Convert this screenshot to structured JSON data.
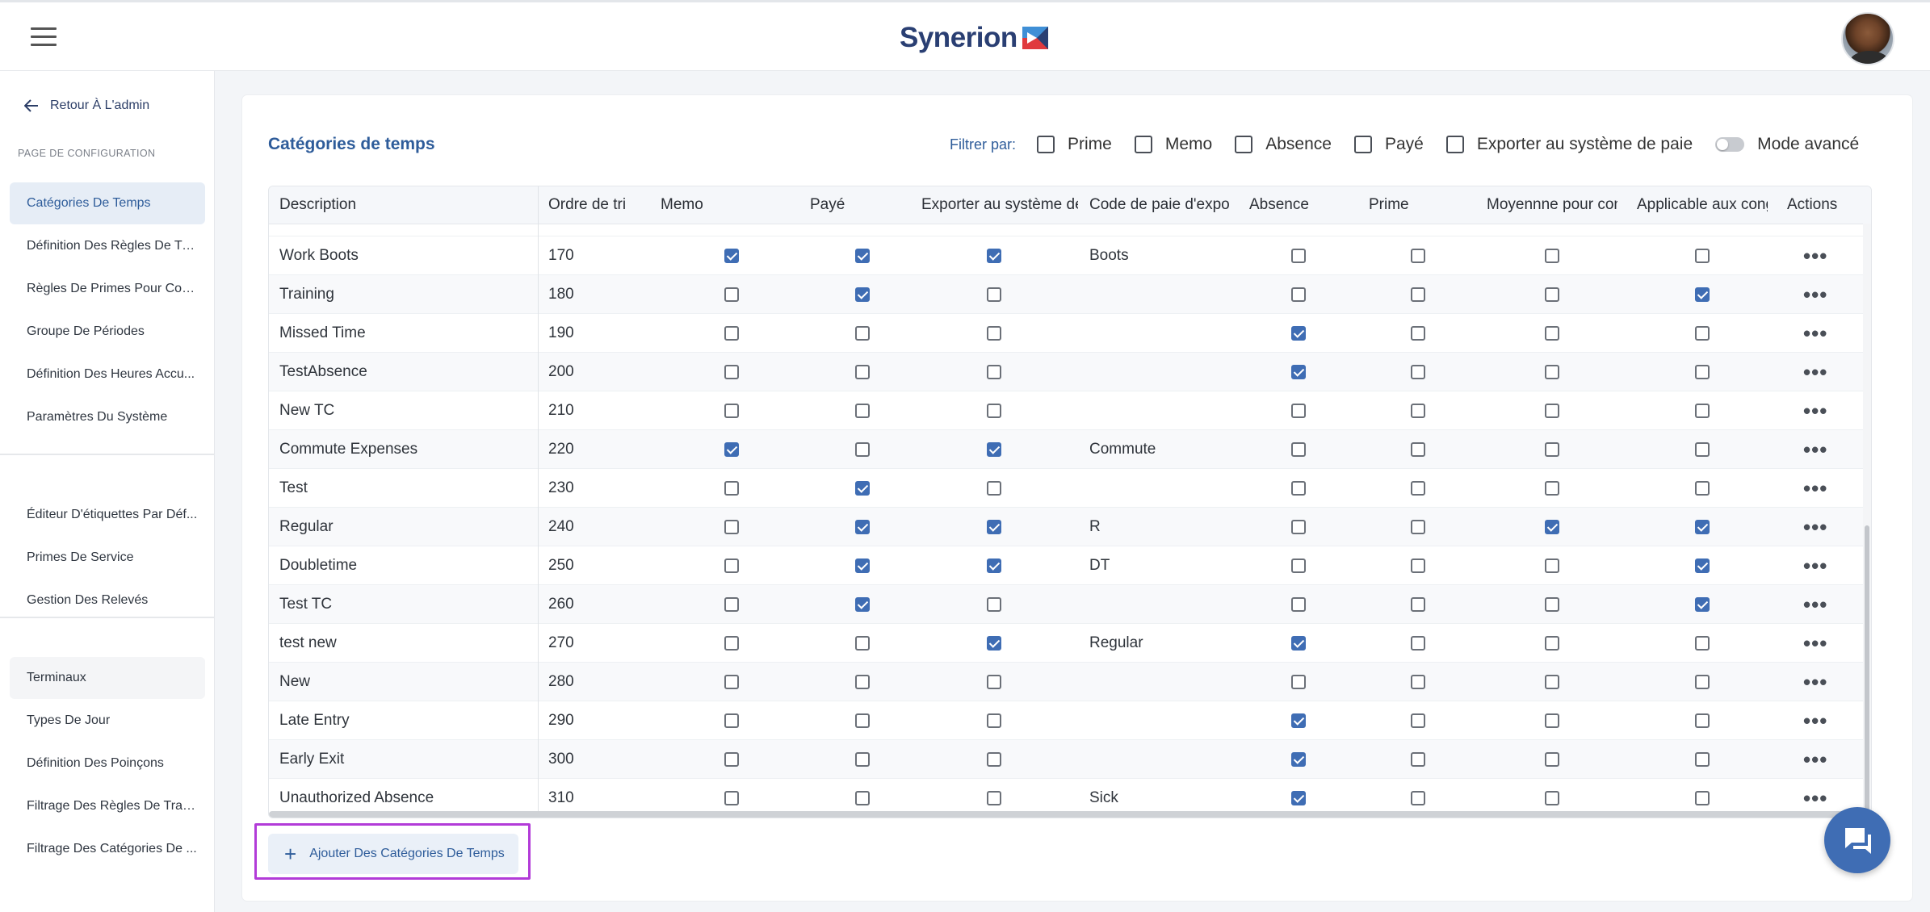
{
  "header": {
    "logo_text": "Synerion"
  },
  "sidebar": {
    "back_label": "Retour À L'admin",
    "section_title": "PAGE DE CONFIGURATION",
    "group1": [
      "Catégories De Temps",
      "Définition Des Règles De Travail",
      "Règles De Primes Pour Con...",
      "Groupe De Périodes",
      "Définition Des Heures Accu...",
      "Paramètres Du Système"
    ],
    "group2": [
      "Éditeur D'étiquettes Par Déf...",
      "Primes De Service",
      "Gestion Des Relevés"
    ],
    "group3": [
      "Terminaux",
      "Types De Jour",
      "Définition Des Poinçons",
      "Filtrage Des Règles De Trav...",
      "Filtrage Des Catégories De ..."
    ]
  },
  "page": {
    "title": "Catégories de temps"
  },
  "filters": {
    "label": "Filtrer par:",
    "items": [
      "Prime",
      "Memo",
      "Absence",
      "Payé",
      "Exporter au système de paie"
    ],
    "advanced_label": "Mode avancé"
  },
  "table": {
    "headers": [
      "Description",
      "Ordre de tri",
      "Memo",
      "Payé",
      "Exporter au système de paie",
      "Code de paie d'exportation",
      "Absence",
      "Prime",
      "Moyennne pour congé",
      "Applicable aux congés",
      "Actions"
    ],
    "rows": [
      {
        "desc": "Work Boots",
        "order": "170",
        "memo": true,
        "paye": true,
        "export": true,
        "code": "Boots",
        "absence": false,
        "prime": false,
        "moy": false,
        "app": false
      },
      {
        "desc": "Training",
        "order": "180",
        "memo": false,
        "paye": true,
        "export": false,
        "code": "",
        "absence": false,
        "prime": false,
        "moy": false,
        "app": true
      },
      {
        "desc": "Missed Time",
        "order": "190",
        "memo": false,
        "paye": false,
        "export": false,
        "code": "",
        "absence": true,
        "prime": false,
        "moy": false,
        "app": false
      },
      {
        "desc": "TestAbsence",
        "order": "200",
        "memo": false,
        "paye": false,
        "export": false,
        "code": "",
        "absence": true,
        "prime": false,
        "moy": false,
        "app": false
      },
      {
        "desc": "New TC",
        "order": "210",
        "memo": false,
        "paye": false,
        "export": false,
        "code": "",
        "absence": false,
        "prime": false,
        "moy": false,
        "app": false
      },
      {
        "desc": "Commute Expenses",
        "order": "220",
        "memo": true,
        "paye": false,
        "export": true,
        "code": "Commute",
        "absence": false,
        "prime": false,
        "moy": false,
        "app": false
      },
      {
        "desc": "Test",
        "order": "230",
        "memo": false,
        "paye": true,
        "export": false,
        "code": "",
        "absence": false,
        "prime": false,
        "moy": false,
        "app": false
      },
      {
        "desc": "Regular",
        "order": "240",
        "memo": false,
        "paye": true,
        "export": true,
        "code": "R",
        "absence": false,
        "prime": false,
        "moy": true,
        "app": true
      },
      {
        "desc": "Doubletime",
        "order": "250",
        "memo": false,
        "paye": true,
        "export": true,
        "code": "DT",
        "absence": false,
        "prime": false,
        "moy": false,
        "app": true
      },
      {
        "desc": "Test TC",
        "order": "260",
        "memo": false,
        "paye": true,
        "export": false,
        "code": "",
        "absence": false,
        "prime": false,
        "moy": false,
        "app": true
      },
      {
        "desc": "test new",
        "order": "270",
        "memo": false,
        "paye": false,
        "export": true,
        "code": "Regular",
        "absence": true,
        "prime": false,
        "moy": false,
        "app": false
      },
      {
        "desc": "New",
        "order": "280",
        "memo": false,
        "paye": false,
        "export": false,
        "code": "",
        "absence": false,
        "prime": false,
        "moy": false,
        "app": false
      },
      {
        "desc": "Late Entry",
        "order": "290",
        "memo": false,
        "paye": false,
        "export": false,
        "code": "",
        "absence": true,
        "prime": false,
        "moy": false,
        "app": false
      },
      {
        "desc": "Early Exit",
        "order": "300",
        "memo": false,
        "paye": false,
        "export": false,
        "code": "",
        "absence": true,
        "prime": false,
        "moy": false,
        "app": false
      },
      {
        "desc": "Unauthorized Absence",
        "order": "310",
        "memo": false,
        "paye": false,
        "export": false,
        "code": "Sick",
        "absence": true,
        "prime": false,
        "moy": false,
        "app": false
      }
    ],
    "actions_label": "•••"
  },
  "add_button": {
    "label": "Ajouter Des Catégories De Temps"
  },
  "colors": {
    "accent": "#3f6db4",
    "title_blue": "#2e5c9a",
    "highlight": "#b23bd8"
  }
}
